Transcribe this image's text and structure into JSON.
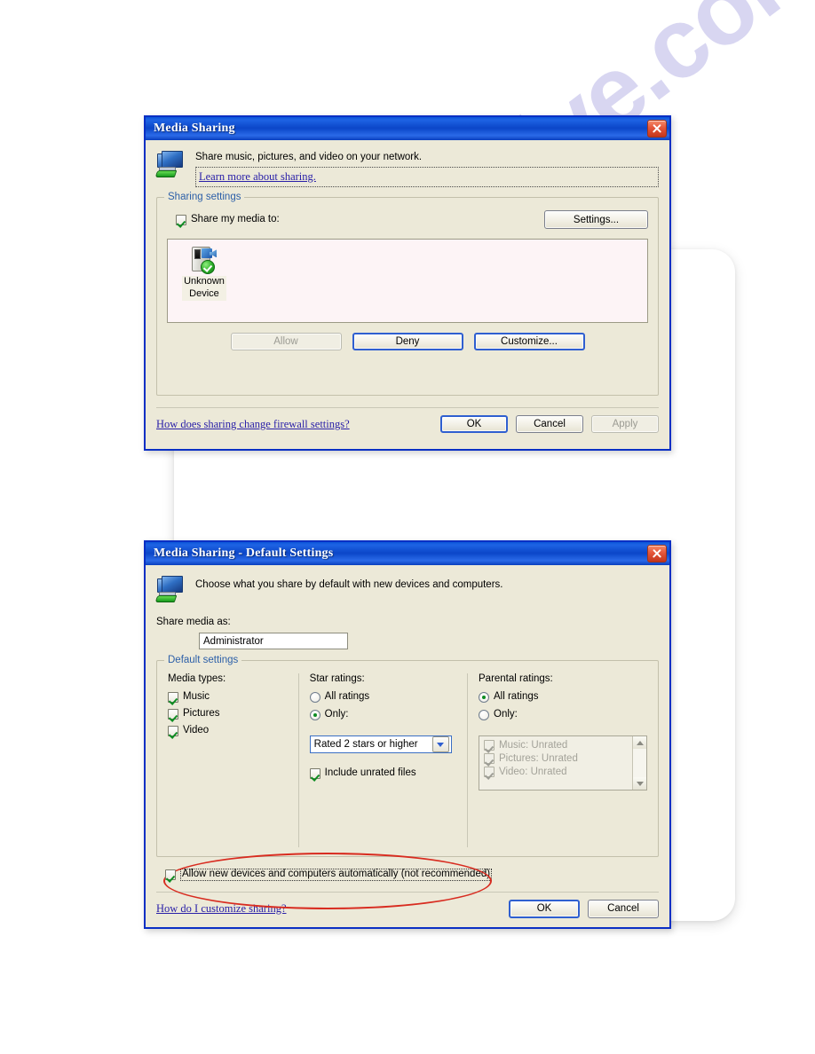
{
  "watermark": {
    "text": "manualshive.com"
  },
  "dialog1": {
    "title": "Media Sharing",
    "close_icon": "close-icon",
    "header": {
      "icon": "computer-network-icon",
      "description": "Share music, pictures, and video on your network.",
      "link": "Learn more about sharing."
    },
    "group": {
      "legend": "Sharing settings",
      "share_checkbox": {
        "label": "Share my media to:",
        "checked": true
      },
      "settings_button": "Settings...",
      "devices": [
        {
          "icon": "unknown-device-allowed-icon",
          "name_line1": "Unknown",
          "name_line2": "Device"
        }
      ],
      "buttons": [
        {
          "label": "Allow",
          "enabled": false
        },
        {
          "label": "Deny",
          "enabled": true
        },
        {
          "label": "Customize...",
          "enabled": true
        }
      ]
    },
    "footer": {
      "link": "How does sharing change firewall settings?",
      "ok": "OK",
      "cancel": "Cancel",
      "apply": "Apply",
      "apply_enabled": false
    }
  },
  "dialog2": {
    "title": "Media Sharing - Default Settings",
    "close_icon": "close-icon",
    "header": {
      "icon": "computer-network-icon",
      "description": "Choose what you share by default with new devices and computers."
    },
    "share_media_as": {
      "label": "Share media as:",
      "value": "Administrator"
    },
    "group": {
      "legend": "Default settings",
      "media_types": {
        "heading": "Media types:",
        "items": [
          {
            "label": "Music",
            "checked": true
          },
          {
            "label": "Pictures",
            "checked": true
          },
          {
            "label": "Video",
            "checked": true
          }
        ]
      },
      "star_ratings": {
        "heading": "Star ratings:",
        "all_label": "All ratings",
        "only_label": "Only:",
        "selected": "only",
        "combo_value": "Rated 2 stars or higher",
        "include_unrated": {
          "label": "Include unrated files",
          "checked": true
        }
      },
      "parental_ratings": {
        "heading": "Parental ratings:",
        "all_label": "All ratings",
        "only_label": "Only:",
        "selected": "all",
        "list": [
          {
            "label": "Music: Unrated",
            "checked": true
          },
          {
            "label": "Pictures: Unrated",
            "checked": true
          },
          {
            "label": "Video: Unrated",
            "checked": true
          }
        ]
      }
    },
    "allow_new": {
      "label": "Allow new devices and computers automatically (not recommended)",
      "checked": true,
      "annotation": "red-ellipse-highlight"
    },
    "footer": {
      "link": "How do I customize sharing?",
      "ok": "OK",
      "cancel": "Cancel"
    }
  },
  "colors": {
    "titlebar_blue": "#0b46c8",
    "dialog_face": "#ece9d8",
    "link_blue": "#1b3fcc",
    "annotation_red": "#d82c20",
    "check_green": "#0d8c22",
    "device_list_bg": "#fdf4f6"
  }
}
